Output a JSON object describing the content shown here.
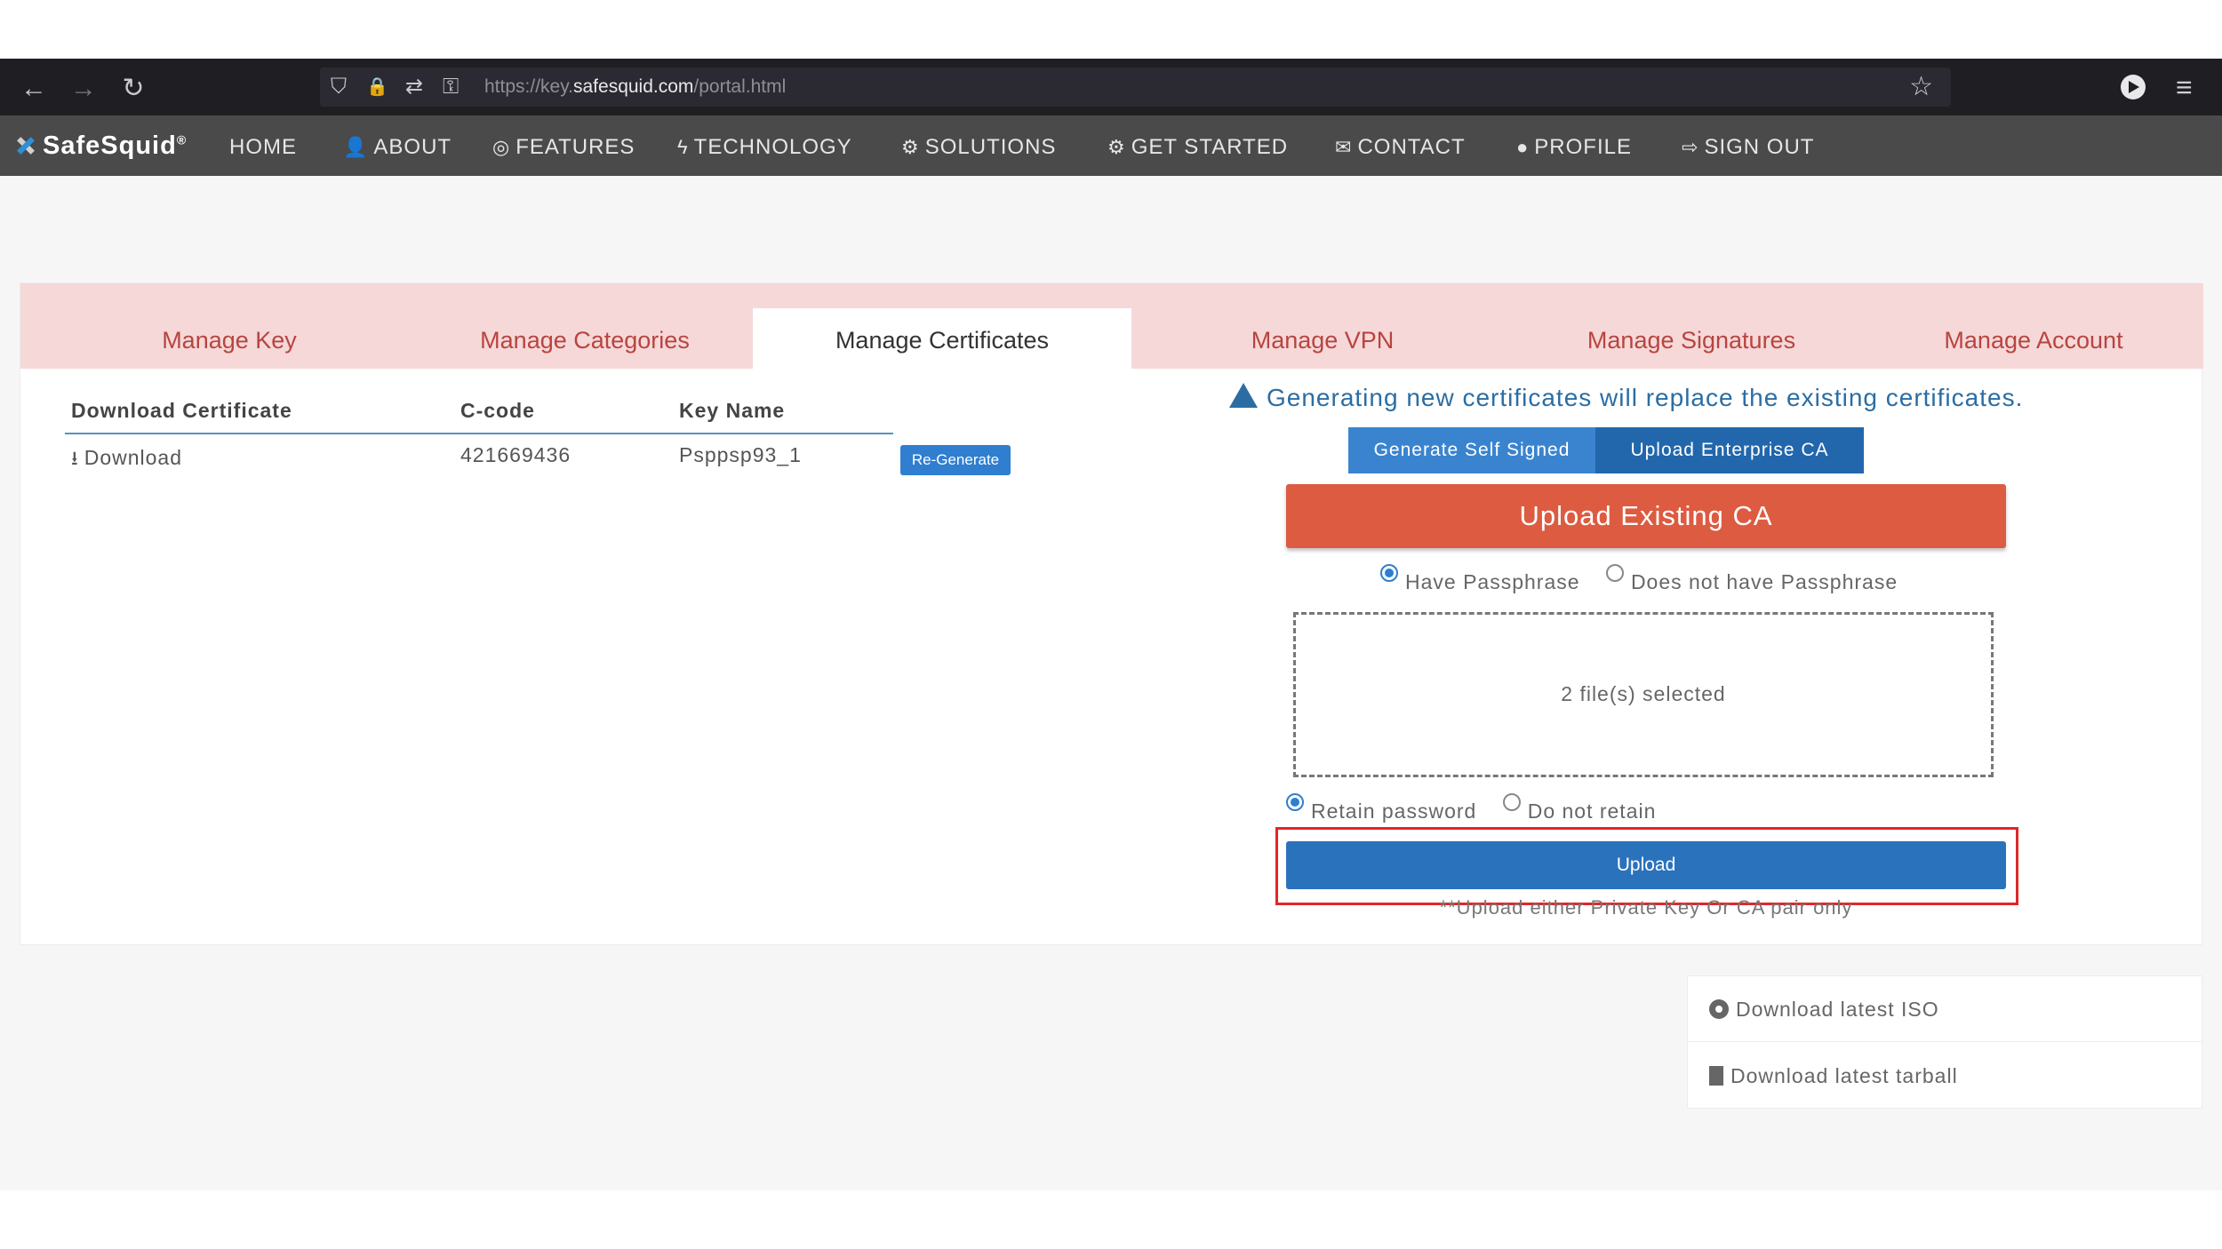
{
  "browser": {
    "url_prefix": "https://key.",
    "url_domain": "safesquid.com",
    "url_path": "/portal.html",
    "back_icon": "←",
    "forward_icon": "→",
    "reload_icon": "↻",
    "star_icon": "☆",
    "menu_icon": "≡",
    "shield_icon": "⛉",
    "lock_icon": "🔒",
    "swap_icon": "⇄",
    "key_icon": "⚿"
  },
  "site_nav": {
    "logo": "SafeSquid",
    "logo_reg": "®",
    "items": [
      {
        "label": "HOME",
        "icon": ""
      },
      {
        "label": "ABOUT",
        "icon": "👤"
      },
      {
        "label": "FEATURES",
        "icon": "◎"
      },
      {
        "label": "TECHNOLOGY",
        "icon": "ϟ"
      },
      {
        "label": "SOLUTIONS",
        "icon": "⚙"
      },
      {
        "label": "GET STARTED",
        "icon": "⚙"
      },
      {
        "label": "CONTACT",
        "icon": "✉"
      },
      {
        "label": "PROFILE",
        "icon": "●"
      },
      {
        "label": "SIGN OUT",
        "icon": "⇨"
      }
    ]
  },
  "tabs": [
    {
      "label": "Manage Key",
      "active": false
    },
    {
      "label": "Manage Categories",
      "active": false
    },
    {
      "label": "Manage Certificates",
      "active": true
    },
    {
      "label": "Manage VPN",
      "active": false
    },
    {
      "label": "Manage Signatures",
      "active": false
    },
    {
      "label": "Manage Account",
      "active": false
    }
  ],
  "table": {
    "headers": [
      "Download Certificate",
      "C-code",
      "Key Name"
    ],
    "row": {
      "download": "Download",
      "ccode": "421669436",
      "key_name": "Psppsp93_1",
      "regen": "Re-Generate"
    }
  },
  "certificates": {
    "warning": "Generating new certificates will replace the existing certificates.",
    "btn_self_signed": "Generate Self Signed",
    "btn_enterprise": "Upload Enterprise CA",
    "upload_existing": "Upload Existing CA",
    "passphrase_options": [
      "Have Passphrase",
      "Does not have Passphrase"
    ],
    "passphrase_selected": "Have Passphrase",
    "dropzone_text": "2 file(s) selected",
    "retain_options": [
      "Retain password",
      "Do not retain"
    ],
    "retain_selected": "Retain password",
    "upload_btn": "Upload",
    "note": "**Upload either Private Key Or CA pair only"
  },
  "downloads": {
    "iso": "Download latest ISO",
    "tarball": "Download latest tarball"
  },
  "colors": {
    "tab_bg": "#f6d8d8",
    "tab_text": "#b84440",
    "primary": "#2b72bd",
    "danger": "#dd5b41",
    "highlight": "#e0272a"
  }
}
